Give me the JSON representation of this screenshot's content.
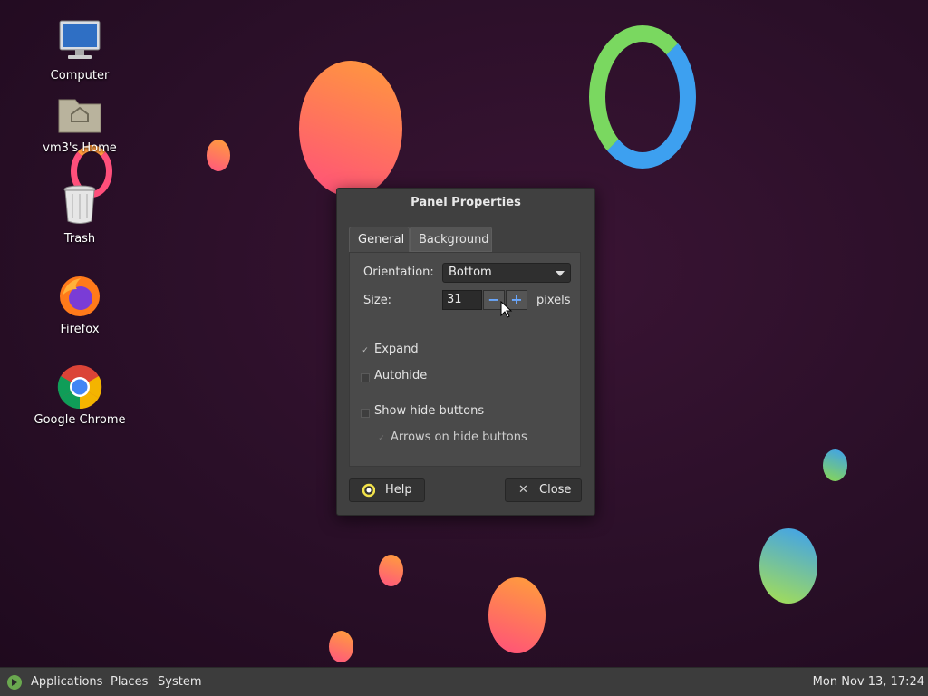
{
  "desktop": {
    "icons": [
      {
        "name": "computer-icon",
        "label": "Computer"
      },
      {
        "name": "home-folder-icon",
        "label": "vm3's Home"
      },
      {
        "name": "trash-icon",
        "label": "Trash"
      },
      {
        "name": "firefox-icon",
        "label": "Firefox"
      },
      {
        "name": "chrome-icon",
        "label": "Google Chrome"
      }
    ]
  },
  "dialog": {
    "title": "Panel Properties",
    "tabs": [
      "General",
      "Background"
    ],
    "orientation_label": "Orientation:",
    "orientation_value": "Bottom",
    "size_label": "Size:",
    "size_value": "31",
    "size_unit": "pixels",
    "expand_label": "Expand",
    "expand_checked": true,
    "autohide_label": "Autohide",
    "autohide_checked": false,
    "show_hide_label": "Show hide buttons",
    "show_hide_checked": false,
    "arrows_label": "Arrows on hide buttons",
    "arrows_checked": true,
    "help_label": "Help",
    "close_label": "Close"
  },
  "taskbar": {
    "applications": "Applications",
    "places": "Places",
    "system": "System",
    "clock": "Mon Nov 13, 17:24"
  },
  "colors": {
    "desktop_bg": "#2a0f28",
    "dialog_bg": "#404040",
    "accent": "#6aa8ff"
  }
}
